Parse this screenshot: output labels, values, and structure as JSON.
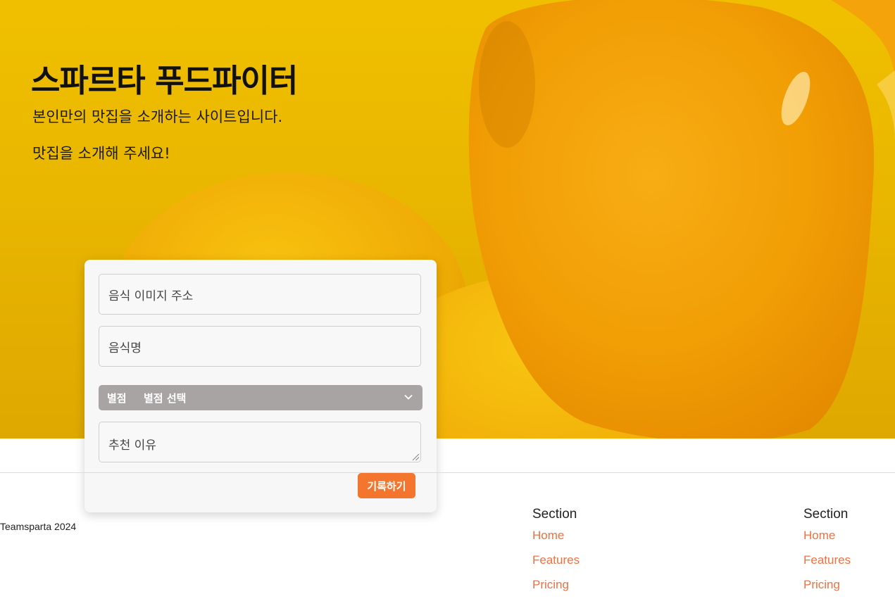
{
  "hero": {
    "title": "스파르타 푸드파이터",
    "subtitle_1": "본인만의 맛집을 소개하는 사이트입니다.",
    "subtitle_2": "맛집을 소개해 주세요!"
  },
  "form": {
    "image_url_placeholder": "음식 이미지 주소",
    "food_name_placeholder": "음식명",
    "rating_label": "별점",
    "rating_selected": "별점 선택",
    "reason_placeholder": "추천 이유",
    "submit_label": "기록하기"
  },
  "footer": {
    "copyright": "Teamsparta 2024",
    "columns": [
      {
        "heading": "Section",
        "links": [
          "Home",
          "Features",
          "Pricing"
        ]
      },
      {
        "heading": "Section",
        "links": [
          "Home",
          "Features",
          "Pricing"
        ]
      }
    ]
  },
  "colors": {
    "accent": "#f4752d",
    "link": "#ef7040",
    "hero_yellow": "#f0c000",
    "select_bg": "#a8a4a4"
  }
}
